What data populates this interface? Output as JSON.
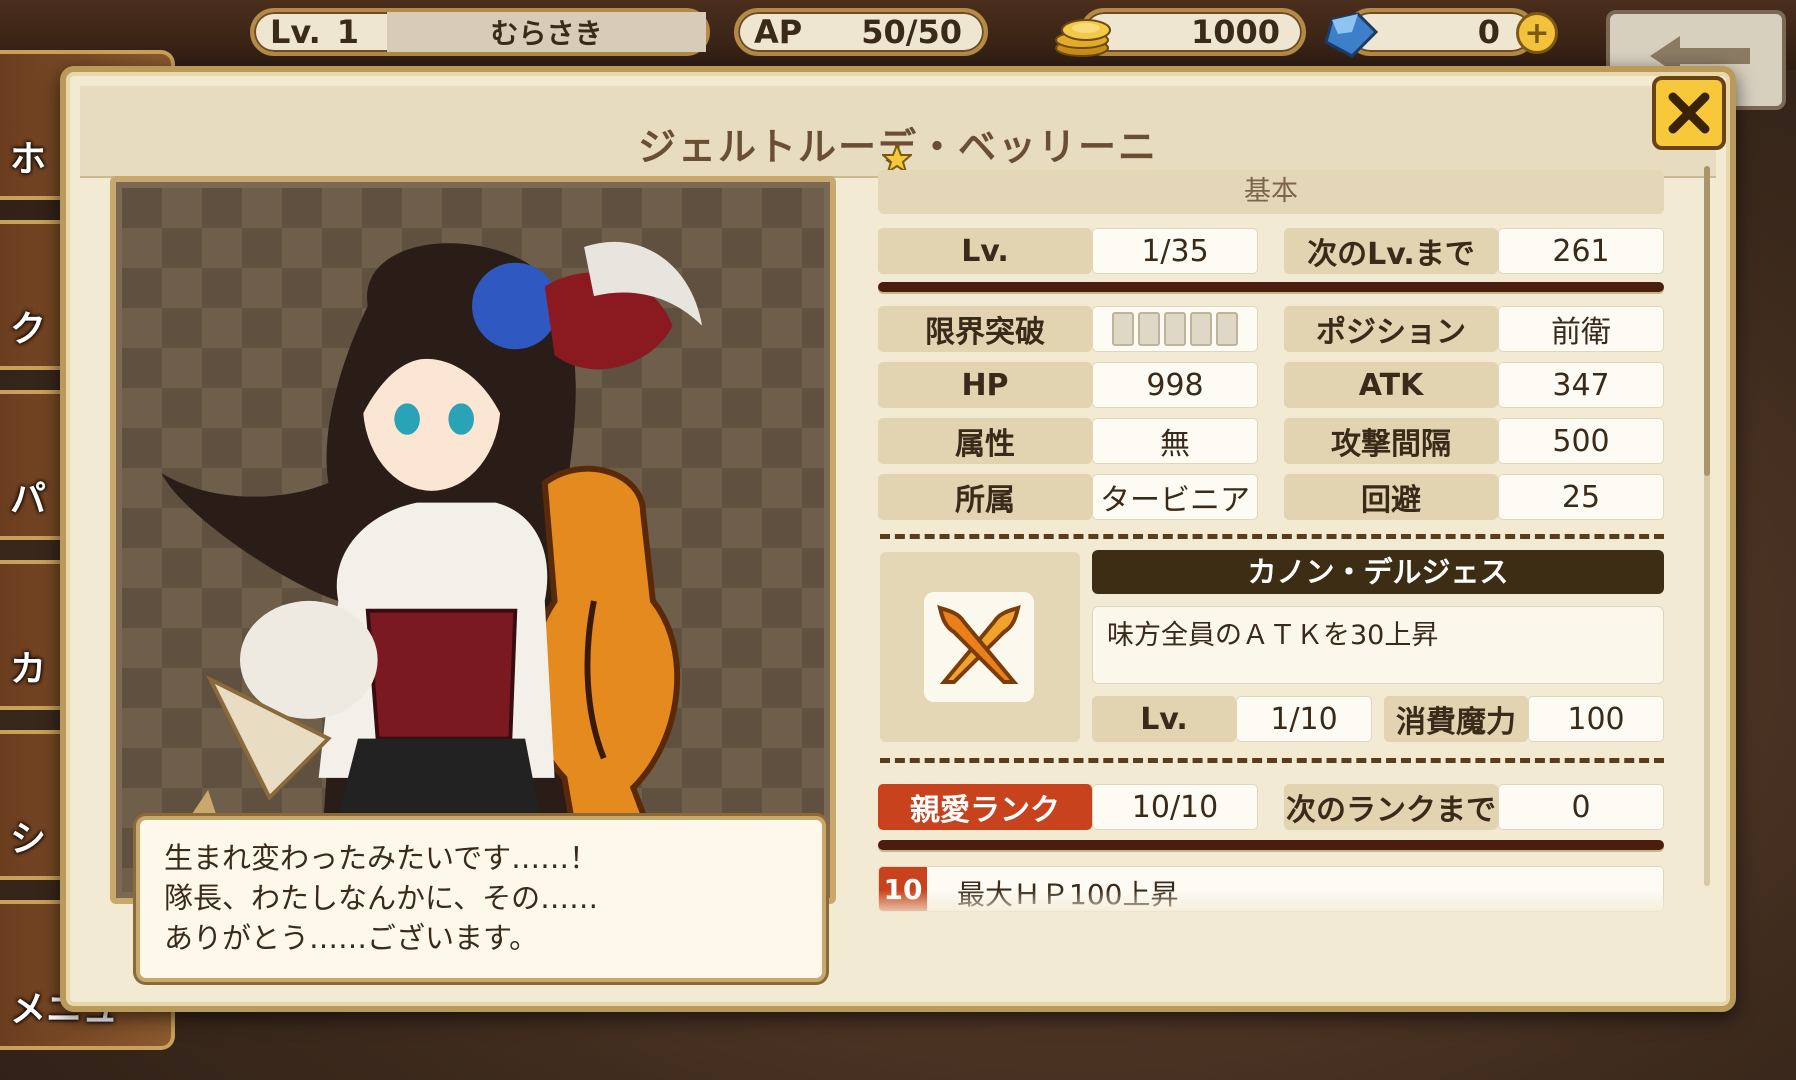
{
  "hud": {
    "level_label": "Lv.",
    "level_value": "1",
    "player_name": "むらさき",
    "ap_label": "AP",
    "ap_value": "50/50",
    "coins": "1000",
    "gems": "0",
    "plus_label": "+"
  },
  "side_menu": {
    "items": [
      "ホ",
      "ク",
      "パ",
      "カ",
      "シ",
      "メニュ"
    ]
  },
  "panel": {
    "character_name": "ジェルトルーデ・ベッリーニ",
    "close_label": "×"
  },
  "speech": {
    "lines": [
      "生まれ変わったみたいです……！",
      "隊長、わたしなんかに、その……",
      "ありがとう……ございます。"
    ]
  },
  "stats": {
    "section": "基本",
    "level_label": "Lv.",
    "level_value": "1/35",
    "next_level_label": "次のLv.まで",
    "next_level_value": "261",
    "breakthrough_label": "限界突破",
    "breakthrough": {
      "current": 0,
      "max": 5
    },
    "position_label": "ポジション",
    "position_value": "前衛",
    "hp_label": "HP",
    "hp_value": "998",
    "atk_label": "ATK",
    "atk_value": "347",
    "attribute_label": "属性",
    "attribute_value": "無",
    "interval_label": "攻撃間隔",
    "interval_value": "500",
    "affiliation_label": "所属",
    "affiliation_value": "タービニア",
    "evasion_label": "回避",
    "evasion_value": "25"
  },
  "skill": {
    "icon": "crossed-swords-icon",
    "name": "カノン・デルジェス",
    "description": "味方全員のＡＴＫを30上昇",
    "level_label": "Lv.",
    "level_value": "1/10",
    "mana_label": "消費魔力",
    "mana_value": "100"
  },
  "affection": {
    "rank_label": "親愛ランク",
    "rank_value": "10/10",
    "next_label": "次のランクまで",
    "next_value": "0",
    "bonus_rank": "10",
    "bonus_text": "最大ＨＰ100上昇"
  },
  "colors": {
    "panel_bg": "#f3ead4",
    "accent_red": "#c8431d",
    "dark_bar": "#4a1d10",
    "close_yellow": "#f6c83a"
  }
}
